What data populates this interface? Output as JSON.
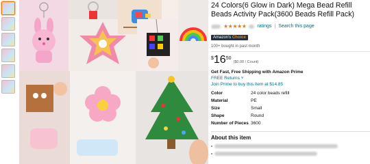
{
  "product": {
    "title": "24 Colors(6 Glow in Dark) Mega Bead Refill Beads Activity Pack(3600 Beads Refill Pack)",
    "ratings_text": "ratings",
    "search_link": "Search this page",
    "badge_brand": "Amazon's",
    "badge_text": "Choice",
    "bought_text": "100+ bought in past month",
    "price_currency": "$",
    "price_whole": "16",
    "price_fraction": "50",
    "price_unit": "($0.00 / Count)",
    "shipping_text": "Get Fast, Free Shipping with Amazon Prime",
    "returns_text": "FREE Returns ˅",
    "prime_offer": "Join Prime to buy this item at $14.85",
    "specs": [
      {
        "key": "Color",
        "value": "24 color beads refill"
      },
      {
        "key": "Material",
        "value": "PE"
      },
      {
        "key": "Size",
        "value": "Small"
      },
      {
        "key": "Shape",
        "value": "Round"
      },
      {
        "key": "Number of Pieces",
        "value": "3600"
      }
    ],
    "about_heading": "About this item"
  },
  "colors": {
    "star": "#de7921",
    "link": "#007185",
    "badge_bg": "#232f3e",
    "badge_accent": "#f08804"
  }
}
